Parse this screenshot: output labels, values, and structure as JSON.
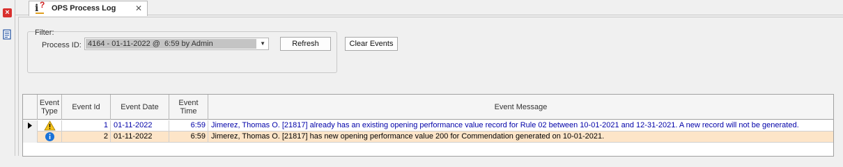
{
  "tab": {
    "title": "OPS Process Log",
    "close": "✕"
  },
  "filter": {
    "group_label": "Filter:",
    "process_id_label": "Process ID:",
    "process_id_value": "4164 - 01-11-2022 @  6:59 by Admin"
  },
  "buttons": {
    "refresh": "Refresh",
    "clear_events": "Clear Events"
  },
  "grid": {
    "columns": [
      "Event Type",
      "Event Id",
      "Event Date",
      "Event Time",
      "Event Message"
    ],
    "rows": [
      {
        "type_icon": "warning-icon",
        "event_id": "1",
        "event_date": "01-11-2022",
        "event_time": "6:59",
        "message": "Jimerez, Thomas O. [21817] already has an existing opening performance value record for Rule 02 between 10-01-2021 and 12-31-2021. A new record will not be generated."
      },
      {
        "type_icon": "info-icon",
        "event_id": "2",
        "event_date": "01-11-2022",
        "event_time": "6:59",
        "message": "Jimerez, Thomas O. [21817] has new opening performance value 200 for Commendation generated on 10-01-2021."
      }
    ]
  },
  "colors": {
    "warning_row_text": "#0000a8",
    "highlight_row_bg": "#fde5c8"
  }
}
